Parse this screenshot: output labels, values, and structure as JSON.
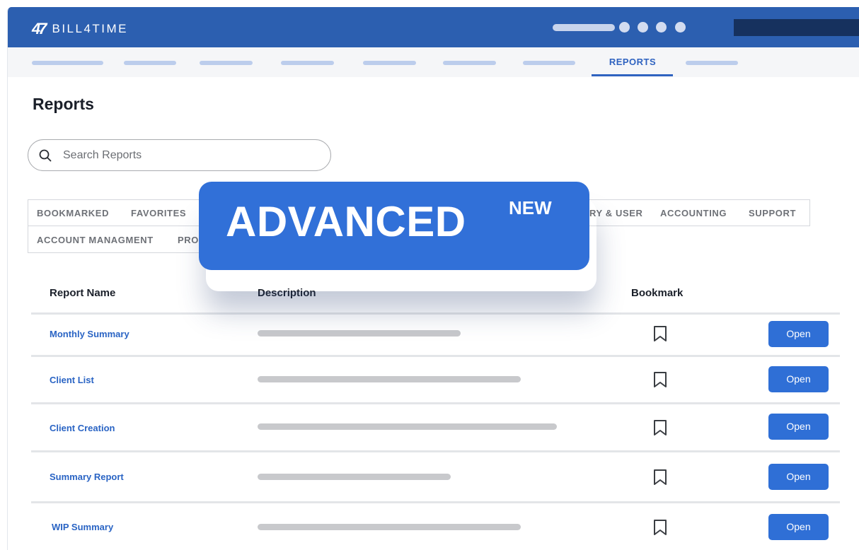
{
  "app": {
    "logo_mark": "47",
    "name": "BILL4TIME"
  },
  "nav": {
    "active_label": "REPORTS"
  },
  "page": {
    "title": "Reports"
  },
  "search": {
    "placeholder": "Search Reports",
    "icon": "search-icon"
  },
  "tabs": {
    "row1": [
      "BOOKMARKED",
      "FAVORITES",
      "RY & USER",
      "ACCOUNTING",
      "SUPPORT"
    ],
    "row2": [
      "ACCOUNT MANAGMENT",
      "PRO"
    ]
  },
  "banner": {
    "text": "ADVANCED",
    "badge": "NEW"
  },
  "table": {
    "headers": {
      "name": "Report Name",
      "description": "Description",
      "bookmark": "Bookmark"
    },
    "open_label": "Open",
    "rows": [
      {
        "name": "Monthly Summary"
      },
      {
        "name": "Client List"
      },
      {
        "name": "Client Creation"
      },
      {
        "name": "Summary Report"
      },
      {
        "name": "WIP Summary"
      }
    ]
  },
  "colors": {
    "header_bg": "#2c5fb0",
    "accent": "#2f6fd6",
    "link": "#2a64c4",
    "banner_bg": "#3170d8"
  }
}
